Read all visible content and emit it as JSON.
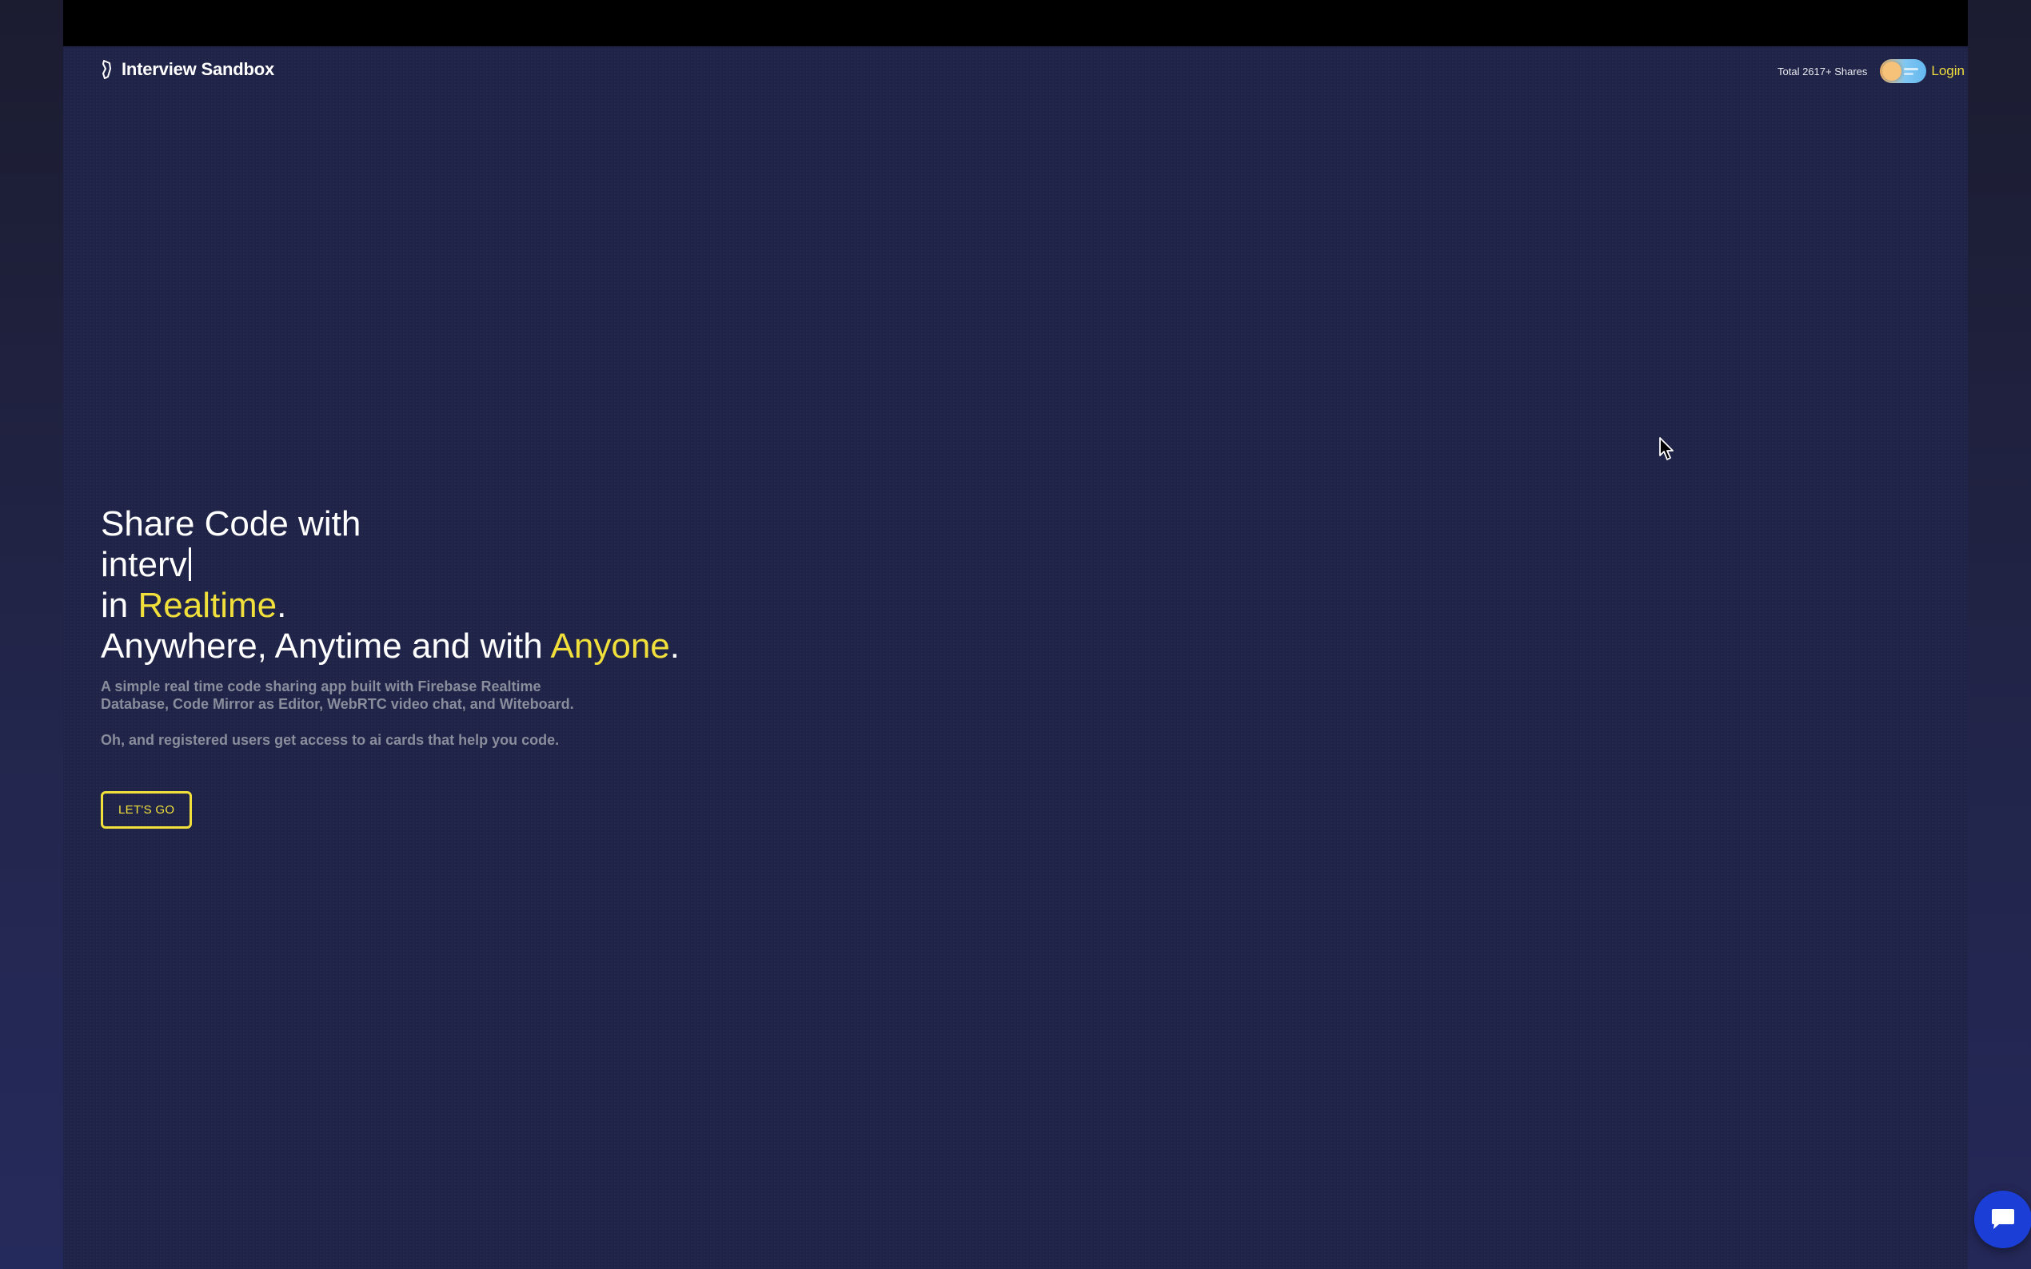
{
  "header": {
    "brand_title": "Interview Sandbox",
    "shares_text": "Total 2617+ Shares",
    "login_label": "Login"
  },
  "hero": {
    "line1": "Share Code with",
    "typed_text": "interv",
    "line3_prefix": "in ",
    "line3_accent": "Realtime",
    "line3_suffix": ".",
    "line4_prefix": "Anywhere, Anytime and with ",
    "line4_accent": "Anyone",
    "line4_suffix": ".",
    "description_1": "A simple real time code sharing app built with Firebase Realtime Database, Code Mirror as Editor, WebRTC video chat, and Witeboard.",
    "description_2": "Oh, and registered users get access to ai cards that help you code.",
    "cta_label": "LET'S GO"
  },
  "colors": {
    "background": "#1f2347",
    "accent": "#f1e03b",
    "chat_button": "#1b3fd6"
  },
  "icons": {
    "brand": "brand-logo-icon",
    "theme_toggle": "theme-toggle",
    "cursor": "mouse-pointer-icon",
    "chat": "chat-bubble-icon"
  }
}
